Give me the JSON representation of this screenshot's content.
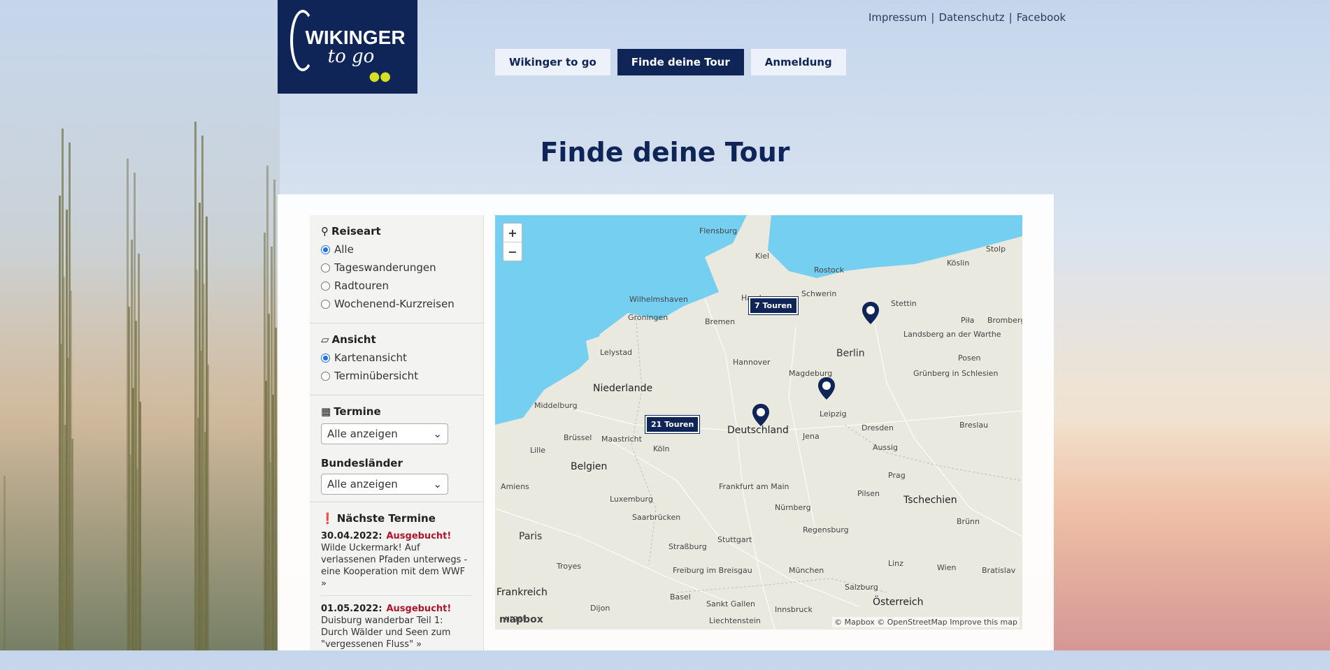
{
  "logo": {
    "line1": "WIKINGER",
    "line2": "to go"
  },
  "toplinks": [
    "Impressum",
    "Datenschutz",
    "Facebook"
  ],
  "nav": [
    "Wikinger to go",
    "Finde deine Tour",
    "Anmeldung"
  ],
  "page_title": "Finde deine Tour",
  "sidebar": {
    "reiseart": {
      "title": "Reiseart",
      "options": [
        "Alle",
        "Tageswanderungen",
        "Radtouren",
        "Wochenend-Kurzreisen"
      ],
      "selected": "Alle"
    },
    "ansicht": {
      "title": "Ansicht",
      "options": [
        "Kartenansicht",
        "Terminübersicht"
      ],
      "selected": "Kartenansicht"
    },
    "termine": {
      "title": "Termine",
      "select_value": "Alle anzeigen"
    },
    "bundeslaender": {
      "title": "Bundesländer",
      "select_value": "Alle anzeigen"
    },
    "naechste": {
      "title": "Nächste Termine",
      "events": [
        {
          "date": "30.04.2022:",
          "status": "Ausgebucht!",
          "text": "Wilde Uckermark! Auf verlassenen Pfaden unterwegs - eine Kooperation mit dem WWF »"
        },
        {
          "date": "01.05.2022:",
          "status": "Ausgebucht!",
          "text": "Duisburg wanderbar Teil 1: Durch Wälder und Seen zum \"vergessenen Fluss\" »"
        }
      ]
    }
  },
  "map": {
    "zoom_in": "+",
    "zoom_out": "−",
    "badges": [
      "7 Touren",
      "21 Touren"
    ],
    "labels": {
      "flensburg": "Flensburg",
      "kiel": "Kiel",
      "rostock": "Rostock",
      "stolp": "Stolp",
      "koeslin": "Köslin",
      "wilhelmshaven": "Wilhelmshaven",
      "hamburg": "Hamburg",
      "schwerin": "Schwerin",
      "stettin": "Stettin",
      "pila": "Piła",
      "bromberg": "Bromberg",
      "groningen": "Groningen",
      "bremen": "Bremen",
      "landsberg": "Landsberg an der Warthe",
      "lelystad": "Lelystad",
      "berlin": "Berlin",
      "hannover": "Hannover",
      "posen": "Posen",
      "magdeburg": "Magdeburg",
      "gruenberg": "Grünberg in Schlesien",
      "niederlande": "Niederlande",
      "leipzig": "Leipzig",
      "middelburg": "Middelburg",
      "deutschland": "Deutschland",
      "dresden": "Dresden",
      "breslau": "Breslau",
      "bruessel": "Brüssel",
      "maastricht": "Maastricht",
      "koeln": "Köln",
      "jena": "Jena",
      "aussig": "Aussig",
      "lille": "Lille",
      "belgien": "Belgien",
      "prag": "Prag",
      "amiens": "Amiens",
      "frankfurt": "Frankfurt am Main",
      "tschechien": "Tschechien",
      "luxemburg": "Luxemburg",
      "pilsen": "Pilsen",
      "saarbruecken": "Saarbrücken",
      "nuernberg": "Nürnberg",
      "paris": "Paris",
      "bruenn": "Brünn",
      "regensburg": "Regensburg",
      "strassburg": "Straßburg",
      "stuttgart": "Stuttgart",
      "troyes": "Troyes",
      "linz": "Linz",
      "freiburg": "Freiburg im Breisgau",
      "muenchen": "München",
      "wien": "Wien",
      "bratislava": "Bratislav",
      "frankreich": "Frankreich",
      "salzburg": "Salzburg",
      "basel": "Basel",
      "stgallen": "Sankt Gallen",
      "oesterreich": "Österreich",
      "dijon": "Dijon",
      "innsbruck": "Innsbruck",
      "liechtenstein": "Liechtenstein",
      "bourges": "urges"
    },
    "mapbox": "mapbox",
    "attribution": "© Mapbox © OpenStreetMap  Improve this map"
  }
}
